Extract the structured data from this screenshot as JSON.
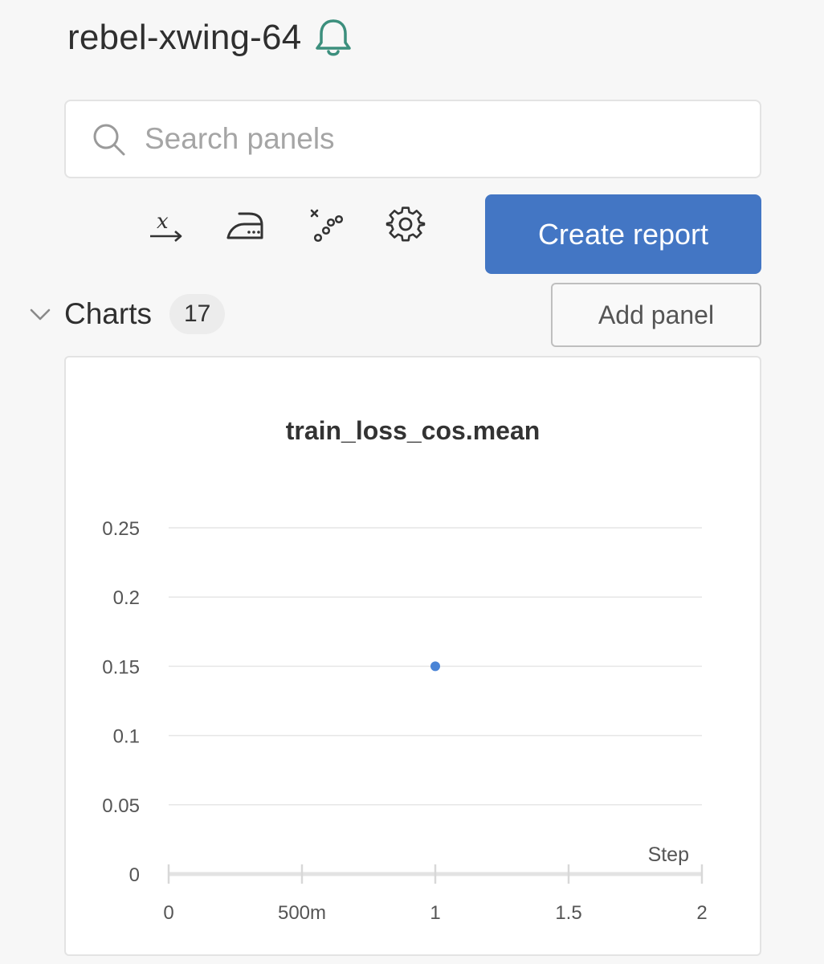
{
  "run": {
    "title": "rebel-xwing-64"
  },
  "search": {
    "placeholder": "Search panels",
    "value": ""
  },
  "toolbar": {
    "icons": [
      "x-axis-icon",
      "smoothing-iron-icon",
      "outlier-scatter-icon",
      "gear-icon"
    ],
    "create_report_label": "Create report"
  },
  "section": {
    "title": "Charts",
    "count": "17",
    "add_panel_label": "Add panel"
  },
  "colors": {
    "accent": "#4376c4",
    "point": "#4a84d6",
    "grid": "#e6e6e6",
    "bell": "#3c8f7d"
  },
  "chart_data": {
    "type": "scatter",
    "title": "train_loss_cos.mean",
    "xlabel": "Step",
    "ylabel": "",
    "xlim": [
      0,
      2
    ],
    "ylim": [
      0,
      0.25
    ],
    "x_ticks": [
      0,
      0.5,
      1,
      1.5,
      2
    ],
    "x_tick_labels": [
      "0",
      "500m",
      "1",
      "1.5",
      "2"
    ],
    "y_ticks": [
      0,
      0.05,
      0.1,
      0.15,
      0.2,
      0.25
    ],
    "y_tick_labels": [
      "0",
      "0.05",
      "0.1",
      "0.15",
      "0.2",
      "0.25"
    ],
    "grid": true,
    "series": [
      {
        "x": [
          1
        ],
        "y": [
          0.15
        ]
      }
    ]
  }
}
